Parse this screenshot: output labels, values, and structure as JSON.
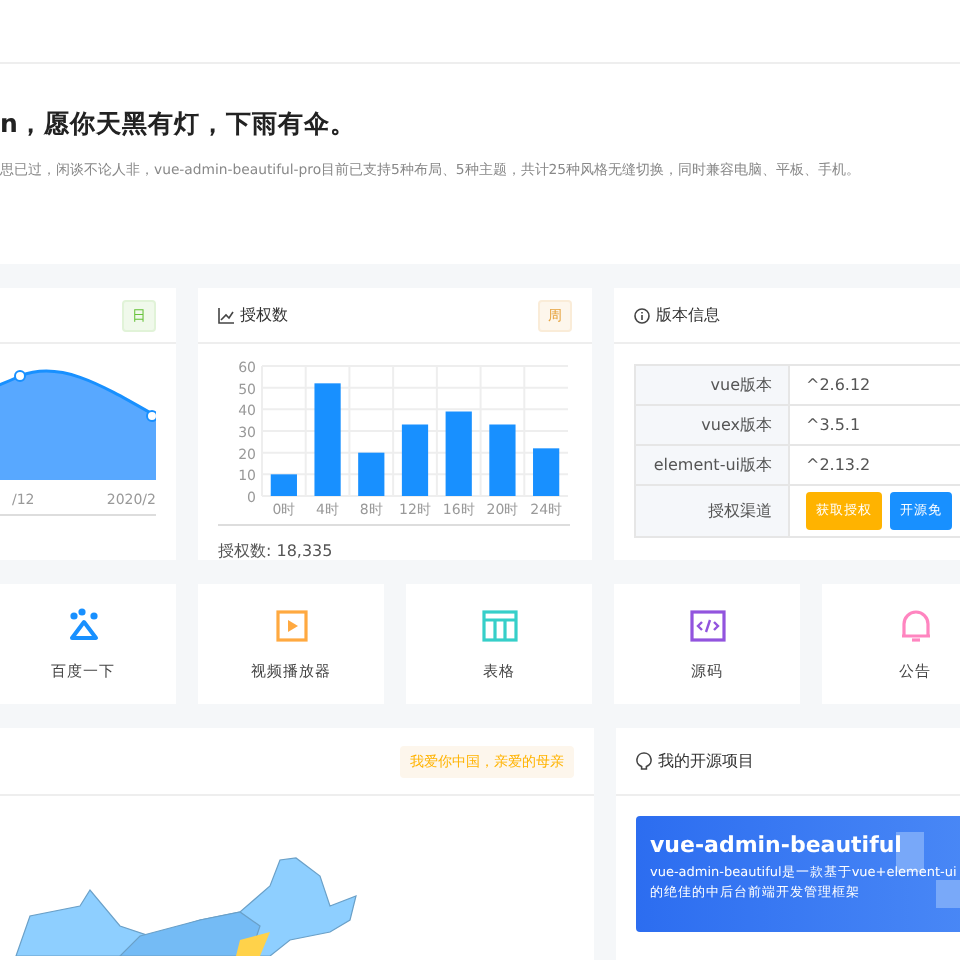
{
  "greeting": {
    "title": "n，愿你天黑有灯，下雨有伞。",
    "description": "思已过，闲谈不论人非，vue-admin-beautiful-pro目前已支持5种布局、5种主题，共计25种风格无缝切换，同时兼容电脑、平板、手机。"
  },
  "visits_card": {
    "tag": "日",
    "axis_labels": [
      "/12",
      "2020/2"
    ]
  },
  "auth_card": {
    "title": "授权数",
    "tag": "周",
    "total": "授权数: 18,335",
    "chart_data": {
      "type": "bar",
      "categories": [
        "0时",
        "4时",
        "8时",
        "12时",
        "16时",
        "20时",
        "24时"
      ],
      "values": [
        10,
        52,
        20,
        33,
        39,
        33,
        22
      ],
      "ylim": [
        0,
        60
      ],
      "grid": true,
      "yticks": [
        0,
        10,
        20,
        30,
        40,
        50,
        60
      ]
    }
  },
  "version_card": {
    "title": "版本信息",
    "rows": [
      {
        "kind": "text",
        "label": "vue版本",
        "value": "^2.6.12"
      },
      {
        "kind": "text",
        "label": "vuex版本",
        "value": "^3.5.1"
      },
      {
        "kind": "text",
        "label": "element-ui版本",
        "value": "^2.13.2"
      },
      {
        "kind": "buttons",
        "label": "授权渠道",
        "buttons": [
          "获取授权",
          "开源免"
        ]
      }
    ]
  },
  "shortcuts": [
    {
      "kind": "paw",
      "label": "百度一下",
      "color": "#1890ff"
    },
    {
      "kind": "play",
      "label": "视频播放器",
      "color": "#ffa940"
    },
    {
      "kind": "table",
      "label": "表格",
      "color": "#36cfc9"
    },
    {
      "kind": "code",
      "label": "源码",
      "color": "#9254de"
    },
    {
      "kind": "bell",
      "label": "公告",
      "color": "#ff85c0"
    }
  ],
  "map_card": {
    "tag": "我爱你中国，亲爱的母亲"
  },
  "project_card": {
    "title": "我的开源项目",
    "banner_title": "vue-admin-beautiful",
    "banner_text": "vue-admin-beautiful是一款基于vue+element-ui的绝佳的中后台前端开发管理框架"
  }
}
